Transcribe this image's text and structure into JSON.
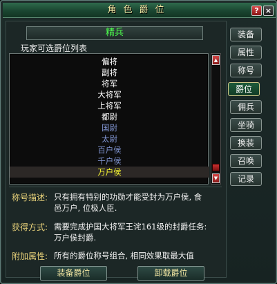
{
  "window": {
    "title": "角色爵位",
    "help_label": "?",
    "close_label": "×"
  },
  "current_rank": "精兵",
  "list_title": "玩家可选爵位列表",
  "rank_list": [
    {
      "label": "偏将",
      "color": "#ffffff"
    },
    {
      "label": "副将",
      "color": "#ffffff"
    },
    {
      "label": "将军",
      "color": "#ffffff"
    },
    {
      "label": "大将军",
      "color": "#ffffff"
    },
    {
      "label": "上将军",
      "color": "#ffffff"
    },
    {
      "label": "都尉",
      "color": "#ffffff"
    },
    {
      "label": "国尉",
      "color": "#7f93cf"
    },
    {
      "label": "太尉",
      "color": "#7f93cf"
    },
    {
      "label": "百户侯",
      "color": "#7f93cf"
    },
    {
      "label": "千户侯",
      "color": "#7f93cf"
    },
    {
      "label": "万户侯",
      "color": "#ffff33"
    }
  ],
  "info": {
    "desc_label": "称号描述:",
    "desc_text_1": "只有拥有特别的功勋才能受封为万户侯, 食",
    "desc_text_2": "邑万户, 位极人臣.",
    "obtain_label": "获得方式:",
    "obtain_text_1": "需要完成护国大将军王诧161级的封爵任务:",
    "obtain_text_2": "万户侯封爵.",
    "attr_label": "附加属性:",
    "attr_text": "所有的爵位称号组合, 相同效果取最大值"
  },
  "buttons": {
    "equip": "装备爵位",
    "unequip": "卸载爵位"
  },
  "side_tabs": [
    {
      "label": "装备",
      "active": false
    },
    {
      "label": "属性",
      "active": false
    },
    {
      "label": "称号",
      "active": false
    },
    {
      "label": "爵位",
      "active": true
    },
    {
      "label": "佣兵",
      "active": false
    },
    {
      "label": "坐骑",
      "active": false
    },
    {
      "label": "换装",
      "active": false
    },
    {
      "label": "召唤",
      "active": false
    },
    {
      "label": "记录",
      "active": false
    }
  ],
  "colors": {
    "title_text": "#f2e6a2",
    "current_rank_text": "#4dff4d",
    "label_yellow": "#e8d27a",
    "selected_item": "#ffff33"
  }
}
